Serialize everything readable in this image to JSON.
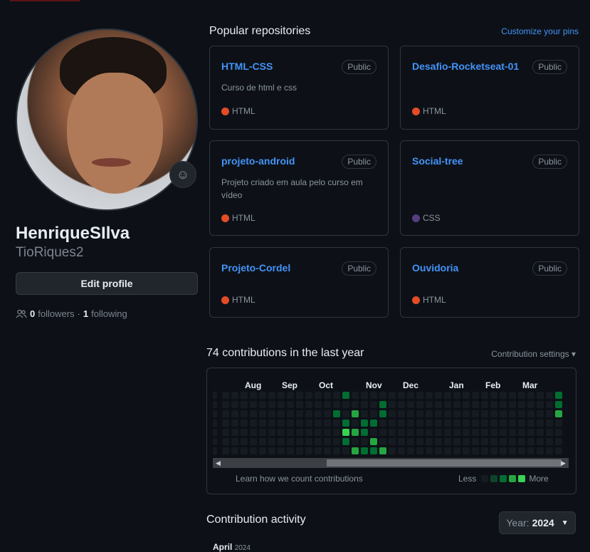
{
  "profile": {
    "name": "HenriqueSIlva",
    "login": "TioRiques2",
    "edit_label": "Edit profile",
    "followers_count": "0",
    "followers_label": "followers",
    "separator": "·",
    "following_count": "1",
    "following_label": "following"
  },
  "repos": {
    "title": "Popular repositories",
    "customize": "Customize your pins",
    "items": [
      {
        "name": "HTML-CSS",
        "badge": "Public",
        "desc": "Curso de html e css",
        "lang": "HTML",
        "lang_color": "#e34c26"
      },
      {
        "name": "Desafio-Rocketseat-01",
        "badge": "Public",
        "desc": "",
        "lang": "HTML",
        "lang_color": "#e34c26"
      },
      {
        "name": "projeto-android",
        "badge": "Public",
        "desc": "Projeto criado em aula pelo curso em vídeo",
        "lang": "HTML",
        "lang_color": "#e34c26"
      },
      {
        "name": "Social-tree",
        "badge": "Public",
        "desc": "",
        "lang": "CSS",
        "lang_color": "#563d7c"
      },
      {
        "name": "Projeto-Cordel",
        "badge": "Public",
        "desc": "",
        "lang": "HTML",
        "lang_color": "#e34c26"
      },
      {
        "name": "Ouvidoria",
        "badge": "Public",
        "desc": "",
        "lang": "HTML",
        "lang_color": "#e34c26"
      }
    ]
  },
  "contributions": {
    "title": "74 contributions in the last year",
    "settings": "Contribution settings ▾",
    "months": [
      "Aug",
      "Sep",
      "Oct",
      "Nov",
      "Dec",
      "Jan",
      "Feb",
      "Mar"
    ],
    "learn": "Learn how we count contributions",
    "less": "Less",
    "more": "More",
    "legend_colors": [
      "#161b22",
      "#0e4429",
      "#006d32",
      "#26a641",
      "#39d353"
    ],
    "weeks": 39,
    "active_cells": [
      {
        "week": 14,
        "day": 3,
        "level": 2
      },
      {
        "week": 14,
        "day": 5,
        "level": 2
      },
      {
        "week": 13,
        "day": 2,
        "level": 2
      },
      {
        "week": 14,
        "day": 0,
        "level": 2
      },
      {
        "week": 14,
        "day": 4,
        "level": 4
      },
      {
        "week": 15,
        "day": 2,
        "level": 3
      },
      {
        "week": 15,
        "day": 4,
        "level": 3
      },
      {
        "week": 15,
        "day": 6,
        "level": 3
      },
      {
        "week": 16,
        "day": 3,
        "level": 2
      },
      {
        "week": 16,
        "day": 4,
        "level": 2
      },
      {
        "week": 16,
        "day": 6,
        "level": 2
      },
      {
        "week": 17,
        "day": 3,
        "level": 2
      },
      {
        "week": 17,
        "day": 5,
        "level": 3
      },
      {
        "week": 17,
        "day": 6,
        "level": 2
      },
      {
        "week": 18,
        "day": 6,
        "level": 3
      },
      {
        "week": 18,
        "day": 1,
        "level": 2
      },
      {
        "week": 18,
        "day": 2,
        "level": 2
      },
      {
        "week": 18,
        "day": 7,
        "level": 3
      },
      {
        "week": 14,
        "day": 7,
        "level": 2
      },
      {
        "week": 17,
        "day": 7,
        "level": 2
      },
      {
        "week": 18,
        "day": 8,
        "level": 3
      },
      {
        "week": 33,
        "day": 7,
        "level": 2
      },
      {
        "week": 37,
        "day": 0,
        "level": 2
      },
      {
        "week": 37,
        "day": 1,
        "level": 2
      },
      {
        "week": 37,
        "day": 2,
        "level": 3
      },
      {
        "week": 37,
        "day": 7,
        "level": 2
      }
    ]
  },
  "activity": {
    "title": "Contribution activity",
    "year_prefix": "Year:",
    "year": "2024",
    "month": "April",
    "month_year": "2024"
  }
}
